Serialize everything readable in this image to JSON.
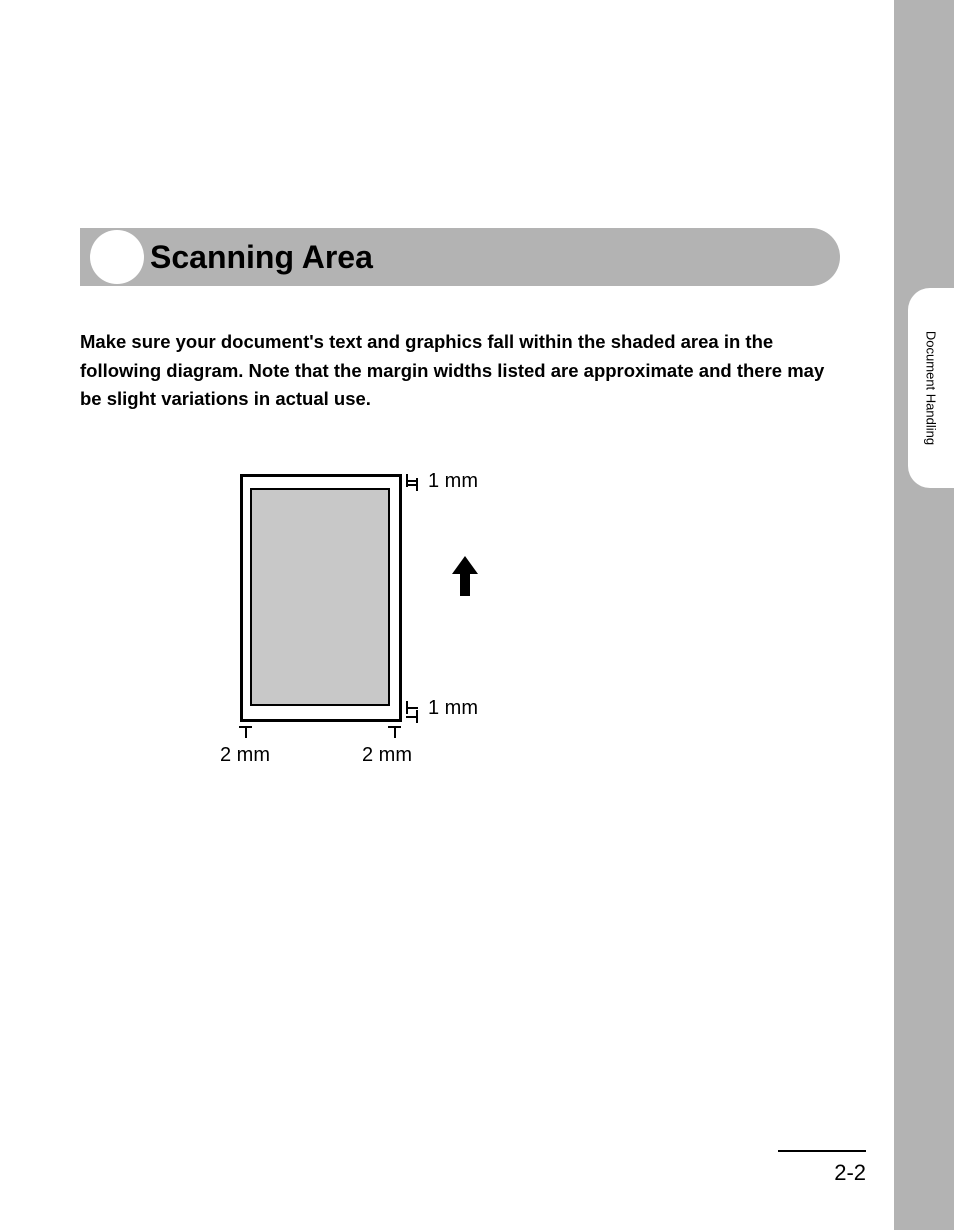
{
  "sidebar": {
    "tab_label": "Document Handling"
  },
  "heading": "Scanning Area",
  "body": "Make sure your document's text and graphics fall within the shaded area in the following diagram. Note that the margin widths listed are approximate and there may be slight variations in actual use.",
  "diagram": {
    "top_margin_label": "1 mm",
    "bottom_margin_label": "1 mm",
    "left_margin_label": "2 mm",
    "right_margin_label": "2 mm"
  },
  "page_number": "2-2"
}
